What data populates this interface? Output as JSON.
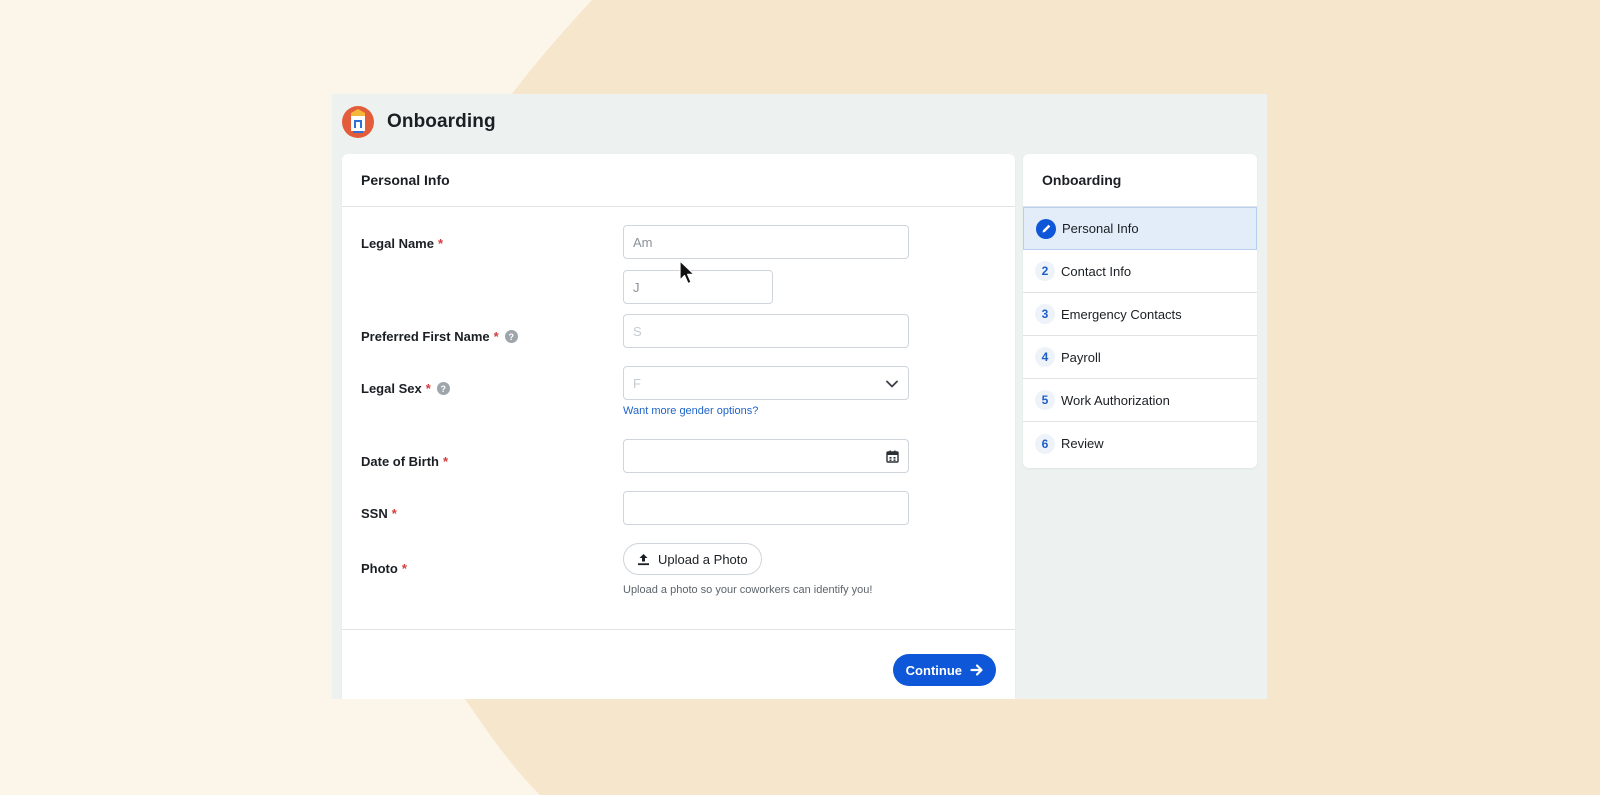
{
  "app": {
    "title": "Onboarding"
  },
  "form": {
    "section_title": "Personal Info",
    "required_marker": "*",
    "help_icon_glyph": "?",
    "fields": {
      "legal_name": {
        "label": "Legal Name",
        "first_value": "Am",
        "last_value": "J"
      },
      "preferred_first_name": {
        "label": "Preferred First Name",
        "value": "S"
      },
      "legal_sex": {
        "label": "Legal Sex",
        "value": "F",
        "link": "Want more gender options?"
      },
      "date_of_birth": {
        "label": "Date of Birth",
        "value": ""
      },
      "ssn": {
        "label": "SSN",
        "value": ""
      },
      "photo": {
        "label": "Photo",
        "button": "Upload a Photo",
        "hint": "Upload a photo so your coworkers can identify you!"
      }
    },
    "continue_label": "Continue"
  },
  "sidebar": {
    "title": "Onboarding",
    "steps": [
      {
        "number": "",
        "label": "Personal Info",
        "active": true,
        "icon": "pencil-icon"
      },
      {
        "number": "2",
        "label": "Contact Info"
      },
      {
        "number": "3",
        "label": "Emergency Contacts"
      },
      {
        "number": "4",
        "label": "Payroll"
      },
      {
        "number": "5",
        "label": "Work Authorization"
      },
      {
        "number": "6",
        "label": "Review"
      }
    ]
  },
  "colors": {
    "accent": "#0d57d8",
    "required": "#d43c3c",
    "link": "#1f63c6",
    "page_background": "#fcf5ea",
    "background_shape": "#f6e6cc"
  }
}
